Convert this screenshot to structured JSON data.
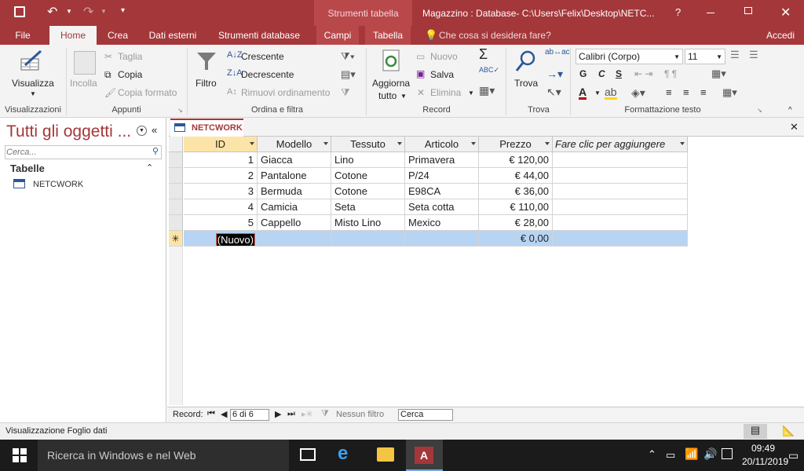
{
  "titlebar": {
    "context_tab": "Strumenti tabella",
    "title": "Magazzino : Database- C:\\Users\\Felix\\Desktop\\NETC...",
    "help": "?"
  },
  "tabs": {
    "file": "File",
    "home": "Home",
    "crea": "Crea",
    "dati_esterni": "Dati esterni",
    "strumenti_db": "Strumenti database",
    "campi": "Campi",
    "tabella": "Tabella",
    "tell_me": "Che cosa si desidera fare?",
    "accedi": "Accedi"
  },
  "ribbon": {
    "visualizza": "Visualizza",
    "incolla": "Incolla",
    "taglia": "Taglia",
    "copia": "Copia",
    "copia_formato": "Copia formato",
    "filtro": "Filtro",
    "crescente": "Crescente",
    "decrescente": "Decrescente",
    "rimuovi_ordinamento": "Rimuovi ordinamento",
    "aggiorna": "Aggiorna",
    "tutto": "tutto",
    "nuovo": "Nuovo",
    "salva": "Salva",
    "elimina": "Elimina",
    "trova": "Trova",
    "font": "Calibri (Corpo)",
    "size": "11",
    "groups": {
      "visualizzazioni": "Visualizzazioni",
      "appunti": "Appunti",
      "ordina": "Ordina e filtra",
      "record": "Record",
      "trova": "Trova",
      "formattazione": "Formattazione testo"
    }
  },
  "nav": {
    "title": "Tutti gli oggetti ...",
    "search_placeholder": "Cerca...",
    "section": "Tabelle",
    "items": [
      {
        "label": "NETCWORK"
      }
    ]
  },
  "doc": {
    "tab_label": "NETCWORK"
  },
  "table": {
    "headers": [
      "ID",
      "Modello",
      "Tessuto",
      "Articolo",
      "Prezzo",
      "Fare clic per aggiungere"
    ],
    "rows": [
      [
        "1",
        "Giacca",
        "Lino",
        "Primavera",
        "€ 120,00"
      ],
      [
        "2",
        "Pantalone",
        "Cotone",
        "P/24",
        "€ 44,00"
      ],
      [
        "3",
        "Bermuda",
        "Cotone",
        "E98CA",
        "€ 36,00"
      ],
      [
        "4",
        "Camicia",
        "Seta",
        "Seta cotta",
        "€ 110,00"
      ],
      [
        "5",
        "Cappello",
        "Misto Lino",
        "Mexico",
        "€ 28,00"
      ]
    ],
    "new_row": {
      "id": "(Nuovo)",
      "prezzo": "€ 0,00"
    }
  },
  "recordnav": {
    "label": "Record:",
    "position": "6 di 6",
    "filter": "Nessun filtro",
    "search": "Cerca"
  },
  "status": {
    "text": "Visualizzazione Foglio dati"
  },
  "taskbar": {
    "search": "Ricerca in Windows e nel Web",
    "time": "09:49",
    "date": "20/11/2019"
  },
  "colors": {
    "accent": "#a4373a",
    "new_row": "#b7d4f3"
  }
}
